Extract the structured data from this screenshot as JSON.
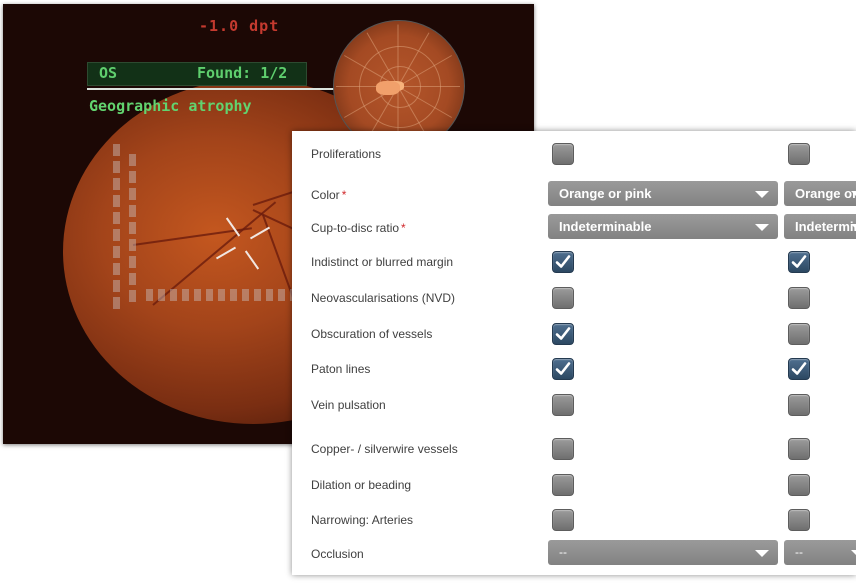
{
  "viewer": {
    "refraction": "-1.0 dpt",
    "eye": "OS",
    "found": "Found: 1/2",
    "diagnosis": "Geographic atrophy"
  },
  "panel": {
    "rows": {
      "proliferations": {
        "label": "Proliferations",
        "col1": false,
        "col2": false
      },
      "color": {
        "label": "Color",
        "required": "*",
        "col1": "Orange or pink",
        "col2": "Orange or pink"
      },
      "cup_disc": {
        "label": "Cup-to-disc ratio",
        "required": "*",
        "col1": "Indeterminable",
        "col2": "Indeterminable"
      },
      "indistinct_margin": {
        "label": "Indistinct or blurred margin",
        "col1": true,
        "col2": true
      },
      "nvd": {
        "label": "Neovascularisations (NVD)",
        "col1": false,
        "col2": false
      },
      "obscuration": {
        "label": "Obscuration of vessels",
        "col1": true,
        "col2": false
      },
      "paton": {
        "label": "Paton lines",
        "col1": true,
        "col2": true
      },
      "vein_pulsation": {
        "label": "Vein pulsation",
        "col1": false,
        "col2": false
      },
      "copper_silver": {
        "label": "Copper- / silverwire vessels",
        "col1": false,
        "col2": false
      },
      "dilation": {
        "label": "Dilation or beading",
        "col1": false,
        "col2": false
      },
      "narrowing": {
        "label": "Narrowing: Arteries",
        "col1": false,
        "col2": false
      },
      "occlusion": {
        "label": "Occlusion",
        "col1": "--",
        "col2": "--"
      }
    }
  },
  "colors": {
    "refraction_text": "#c43a2f",
    "hud_text": "#5fcf6e",
    "checkbox_checked": "#2c4862",
    "checkbox_unchecked": "#7a7a7a",
    "select_bg": "#8c8c8c",
    "required_mark": "#d0282c"
  },
  "icons": {
    "checkbox_checked": "check-icon",
    "select_arrow": "chevron-down-icon",
    "reticle": "crosshair-icon"
  }
}
